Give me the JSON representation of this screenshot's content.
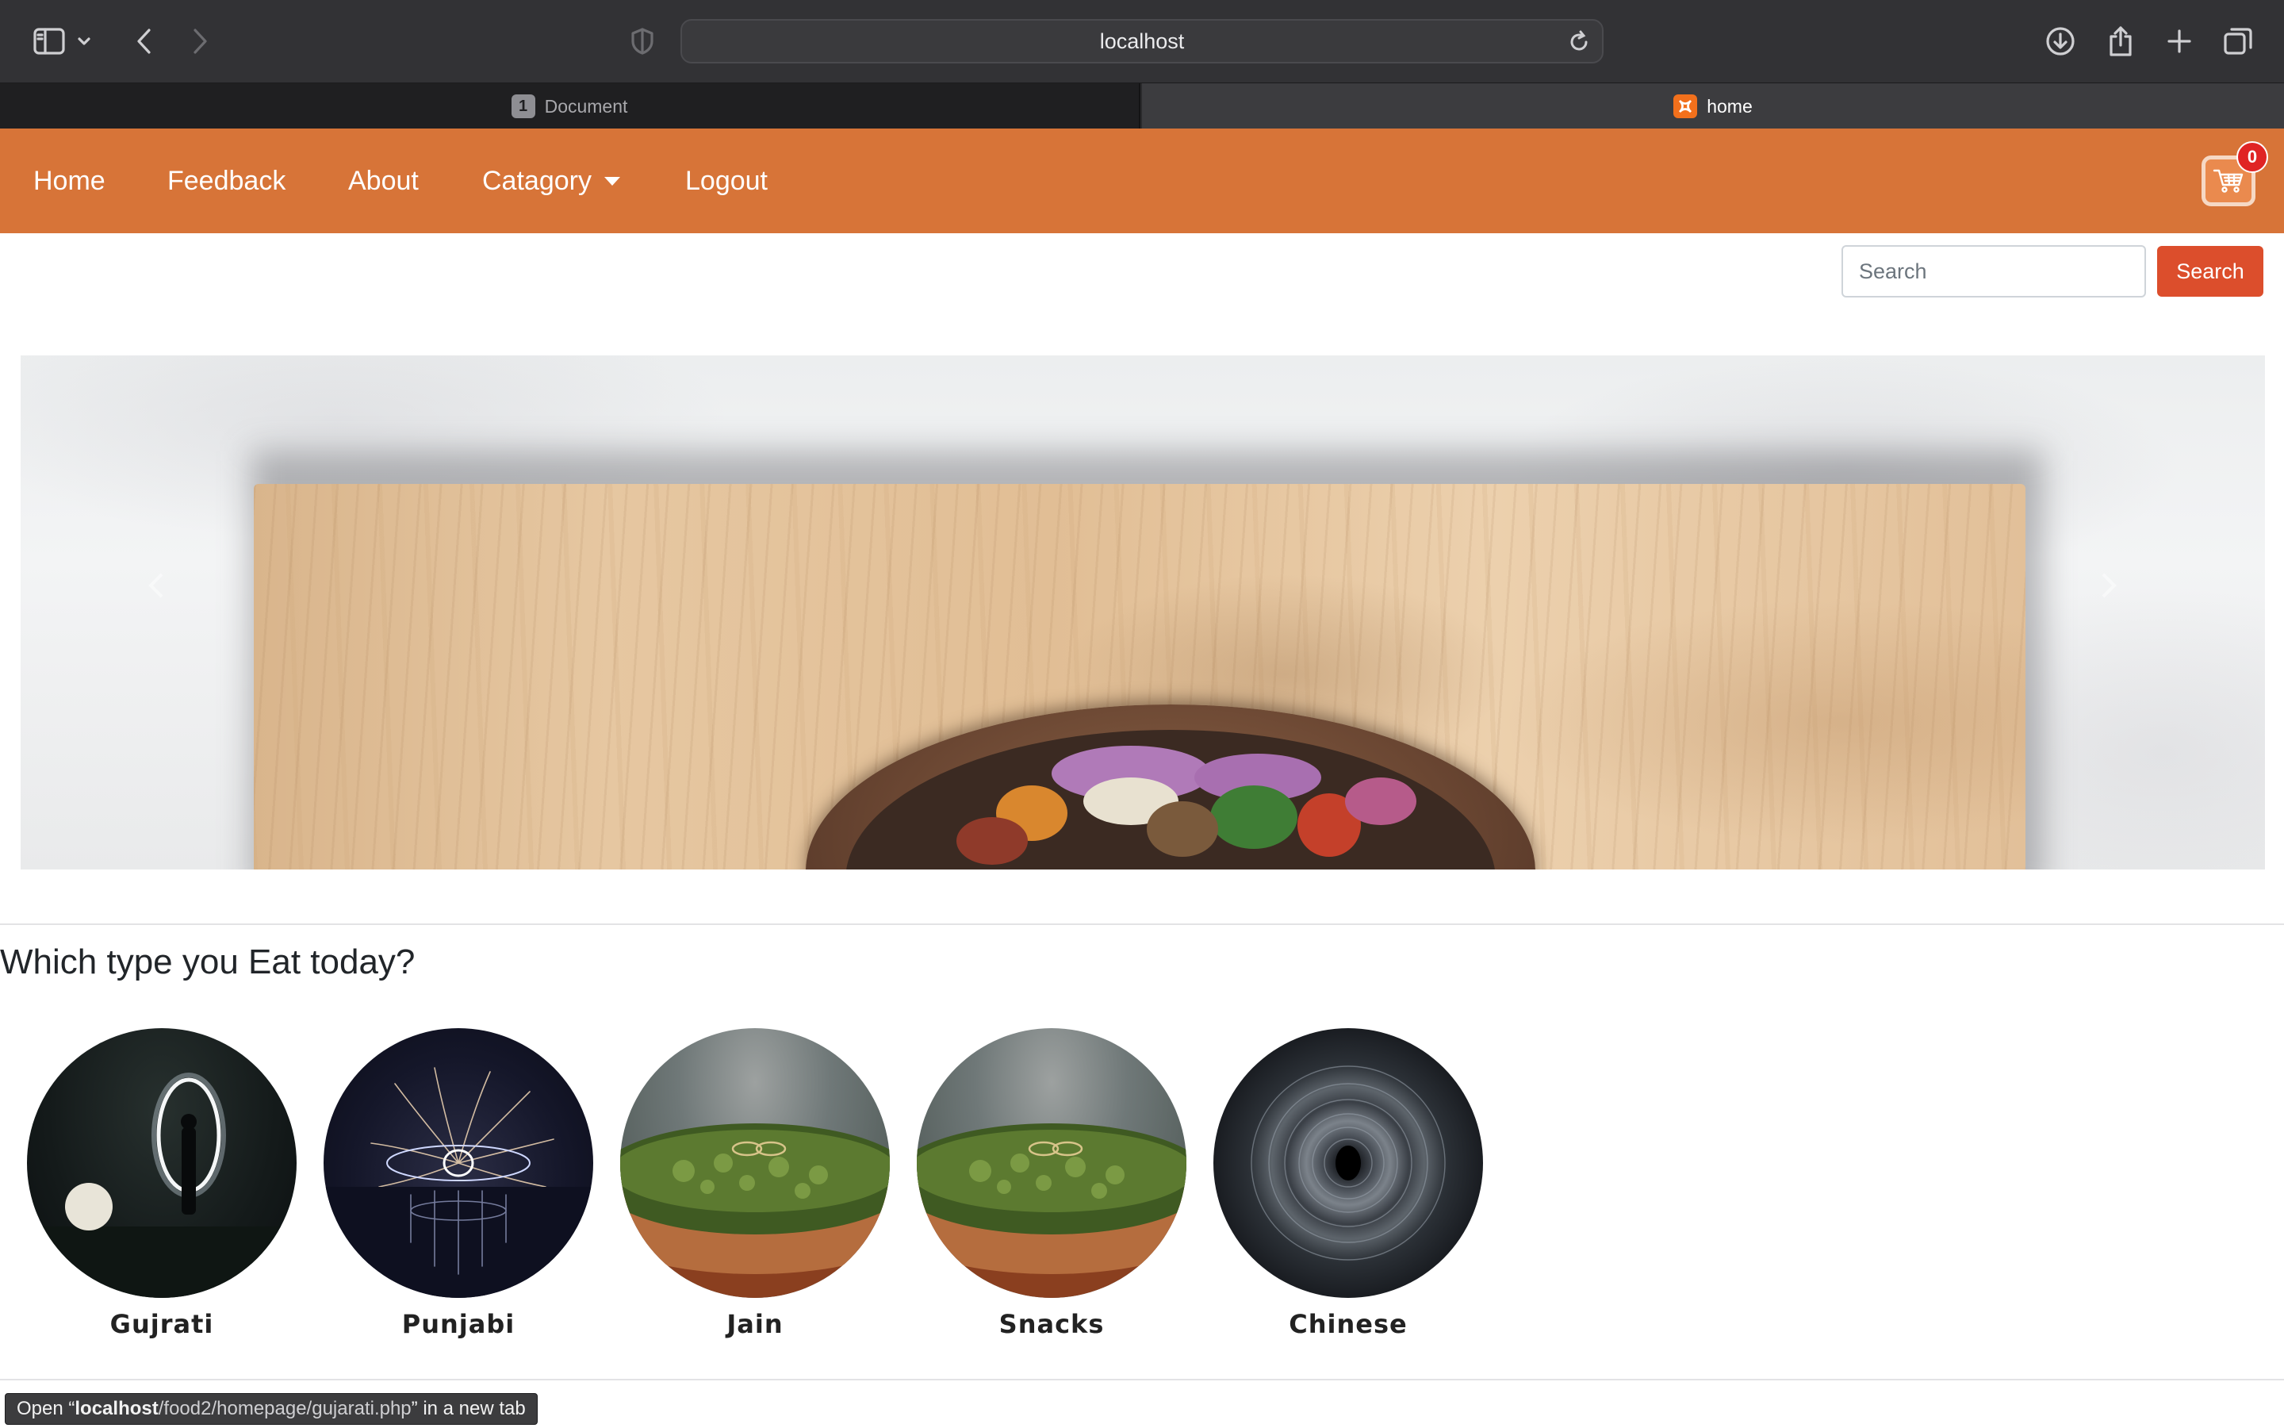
{
  "browser": {
    "address": "localhost",
    "tabs": [
      {
        "label": "Document",
        "badge": "1",
        "active": false
      },
      {
        "label": "home",
        "active": true
      }
    ],
    "icons": {
      "sidebar": "sidebar-icon",
      "tab_menu": "chevron-down-icon",
      "back": "back-arrow-icon",
      "forward": "forward-arrow-icon",
      "privacy": "shield-icon",
      "reload": "reload-icon",
      "download": "download-icon",
      "share": "share-icon",
      "new_tab": "plus-icon",
      "tab_overview": "tabs-overview-icon"
    }
  },
  "navbar": {
    "items": [
      "Home",
      "Feedback",
      "About",
      "Catagory",
      "Logout"
    ],
    "cart_count": "0",
    "colors": {
      "background": "#d77438",
      "text": "#ffffff"
    }
  },
  "search": {
    "placeholder": "Search",
    "value": "",
    "button_label": "Search",
    "button_color": "#dc4e2c"
  },
  "hero": {
    "image_icon": "food-salad-bowl-image"
  },
  "categories": {
    "title": "Which type you Eat today?",
    "items": [
      {
        "label": "Gujrati"
      },
      {
        "label": "Punjabi"
      },
      {
        "label": "Jain"
      },
      {
        "label": "Snacks"
      },
      {
        "label": "Chinese"
      }
    ]
  },
  "status_bar": {
    "prefix": "Open “",
    "host": "localhost",
    "path": "/food2/homepage/gujarati.php",
    "suffix": "” in a new tab"
  }
}
